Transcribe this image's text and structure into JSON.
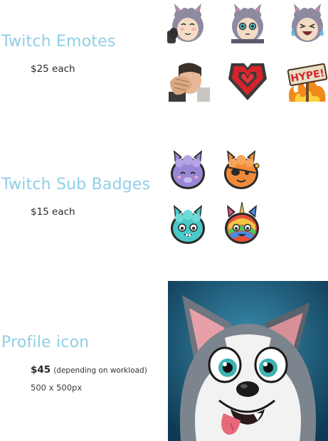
{
  "sections": {
    "emotes": {
      "title": "Twitch Emotes",
      "price": "$25 each"
    },
    "badges": {
      "title": "Twitch Sub Badges",
      "price": "$15 each"
    },
    "profile": {
      "title": "Profile icon",
      "price": "$45",
      "note": "(depending on workload)",
      "size": "500 x 500px"
    }
  },
  "colors": {
    "heading": "#8fcfe6",
    "llama_gray": "#8e8aa0",
    "badge_purple": "#9a86d6",
    "badge_orange": "#f08a3a",
    "badge_teal": "#49c9c8",
    "profile_bg": "#1f5f7f"
  },
  "icons": [
    "llama-smile-emote",
    "llama-glasses-emote",
    "llama-laugh-emote",
    "facepalm-emote",
    "heart-emote",
    "hype-sign-emote",
    "purple-llama-badge",
    "pirate-llama-badge",
    "teal-llama-badge",
    "rainbow-unicorn-llama-badge",
    "husky-dog-portrait"
  ],
  "hype_text": "HYPE!"
}
